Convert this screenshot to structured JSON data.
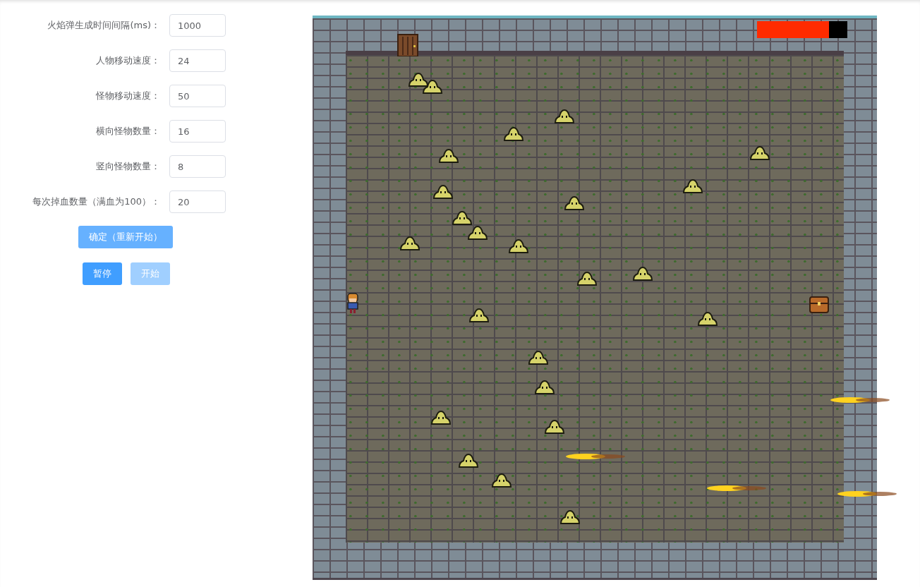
{
  "settings": [
    {
      "label": "火焰弹生成时间间隔(ms)：",
      "value": "1000"
    },
    {
      "label": "人物移动速度：",
      "value": "24"
    },
    {
      "label": "怪物移动速度：",
      "value": "50"
    },
    {
      "label": "横向怪物数量：",
      "value": "16"
    },
    {
      "label": "竖向怪物数量：",
      "value": "8"
    },
    {
      "label": "每次掉血数量（满血为100）：",
      "value": "20"
    }
  ],
  "confirm_button": {
    "label": "确定（重新开始）",
    "hovered": true
  },
  "controls": [
    {
      "label": "暂停",
      "disabled": false
    },
    {
      "label": "开始",
      "disabled": true
    }
  ],
  "game": {
    "health": {
      "level": 0.8
    }
  }
}
